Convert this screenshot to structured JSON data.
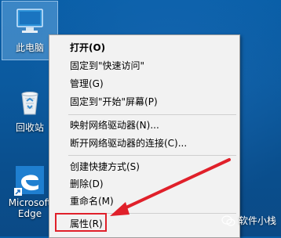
{
  "desktop": {
    "icons": [
      {
        "label": "此电脑"
      },
      {
        "label": "回收站"
      },
      {
        "label_line1": "Microsoft",
        "label_line2": "Edge"
      }
    ]
  },
  "context_menu": {
    "items": [
      {
        "label": "打开(O)"
      },
      {
        "label": "固定到\"快速访问\""
      },
      {
        "label": "管理(G)"
      },
      {
        "label": "固定到\"开始\"屏幕(P)"
      },
      {
        "label": "映射网络驱动器(N)..."
      },
      {
        "label": "断开网络驱动器的连接(C)..."
      },
      {
        "label": "创建快捷方式(S)"
      },
      {
        "label": "删除(D)"
      },
      {
        "label": "重命名(M)"
      },
      {
        "label": "属性(R)"
      }
    ]
  },
  "watermark": {
    "text": "软件小栈"
  },
  "colors": {
    "highlight": "#e0202a",
    "menu_bg": "#f2f2f2",
    "desktop": "#0a5fa8"
  }
}
